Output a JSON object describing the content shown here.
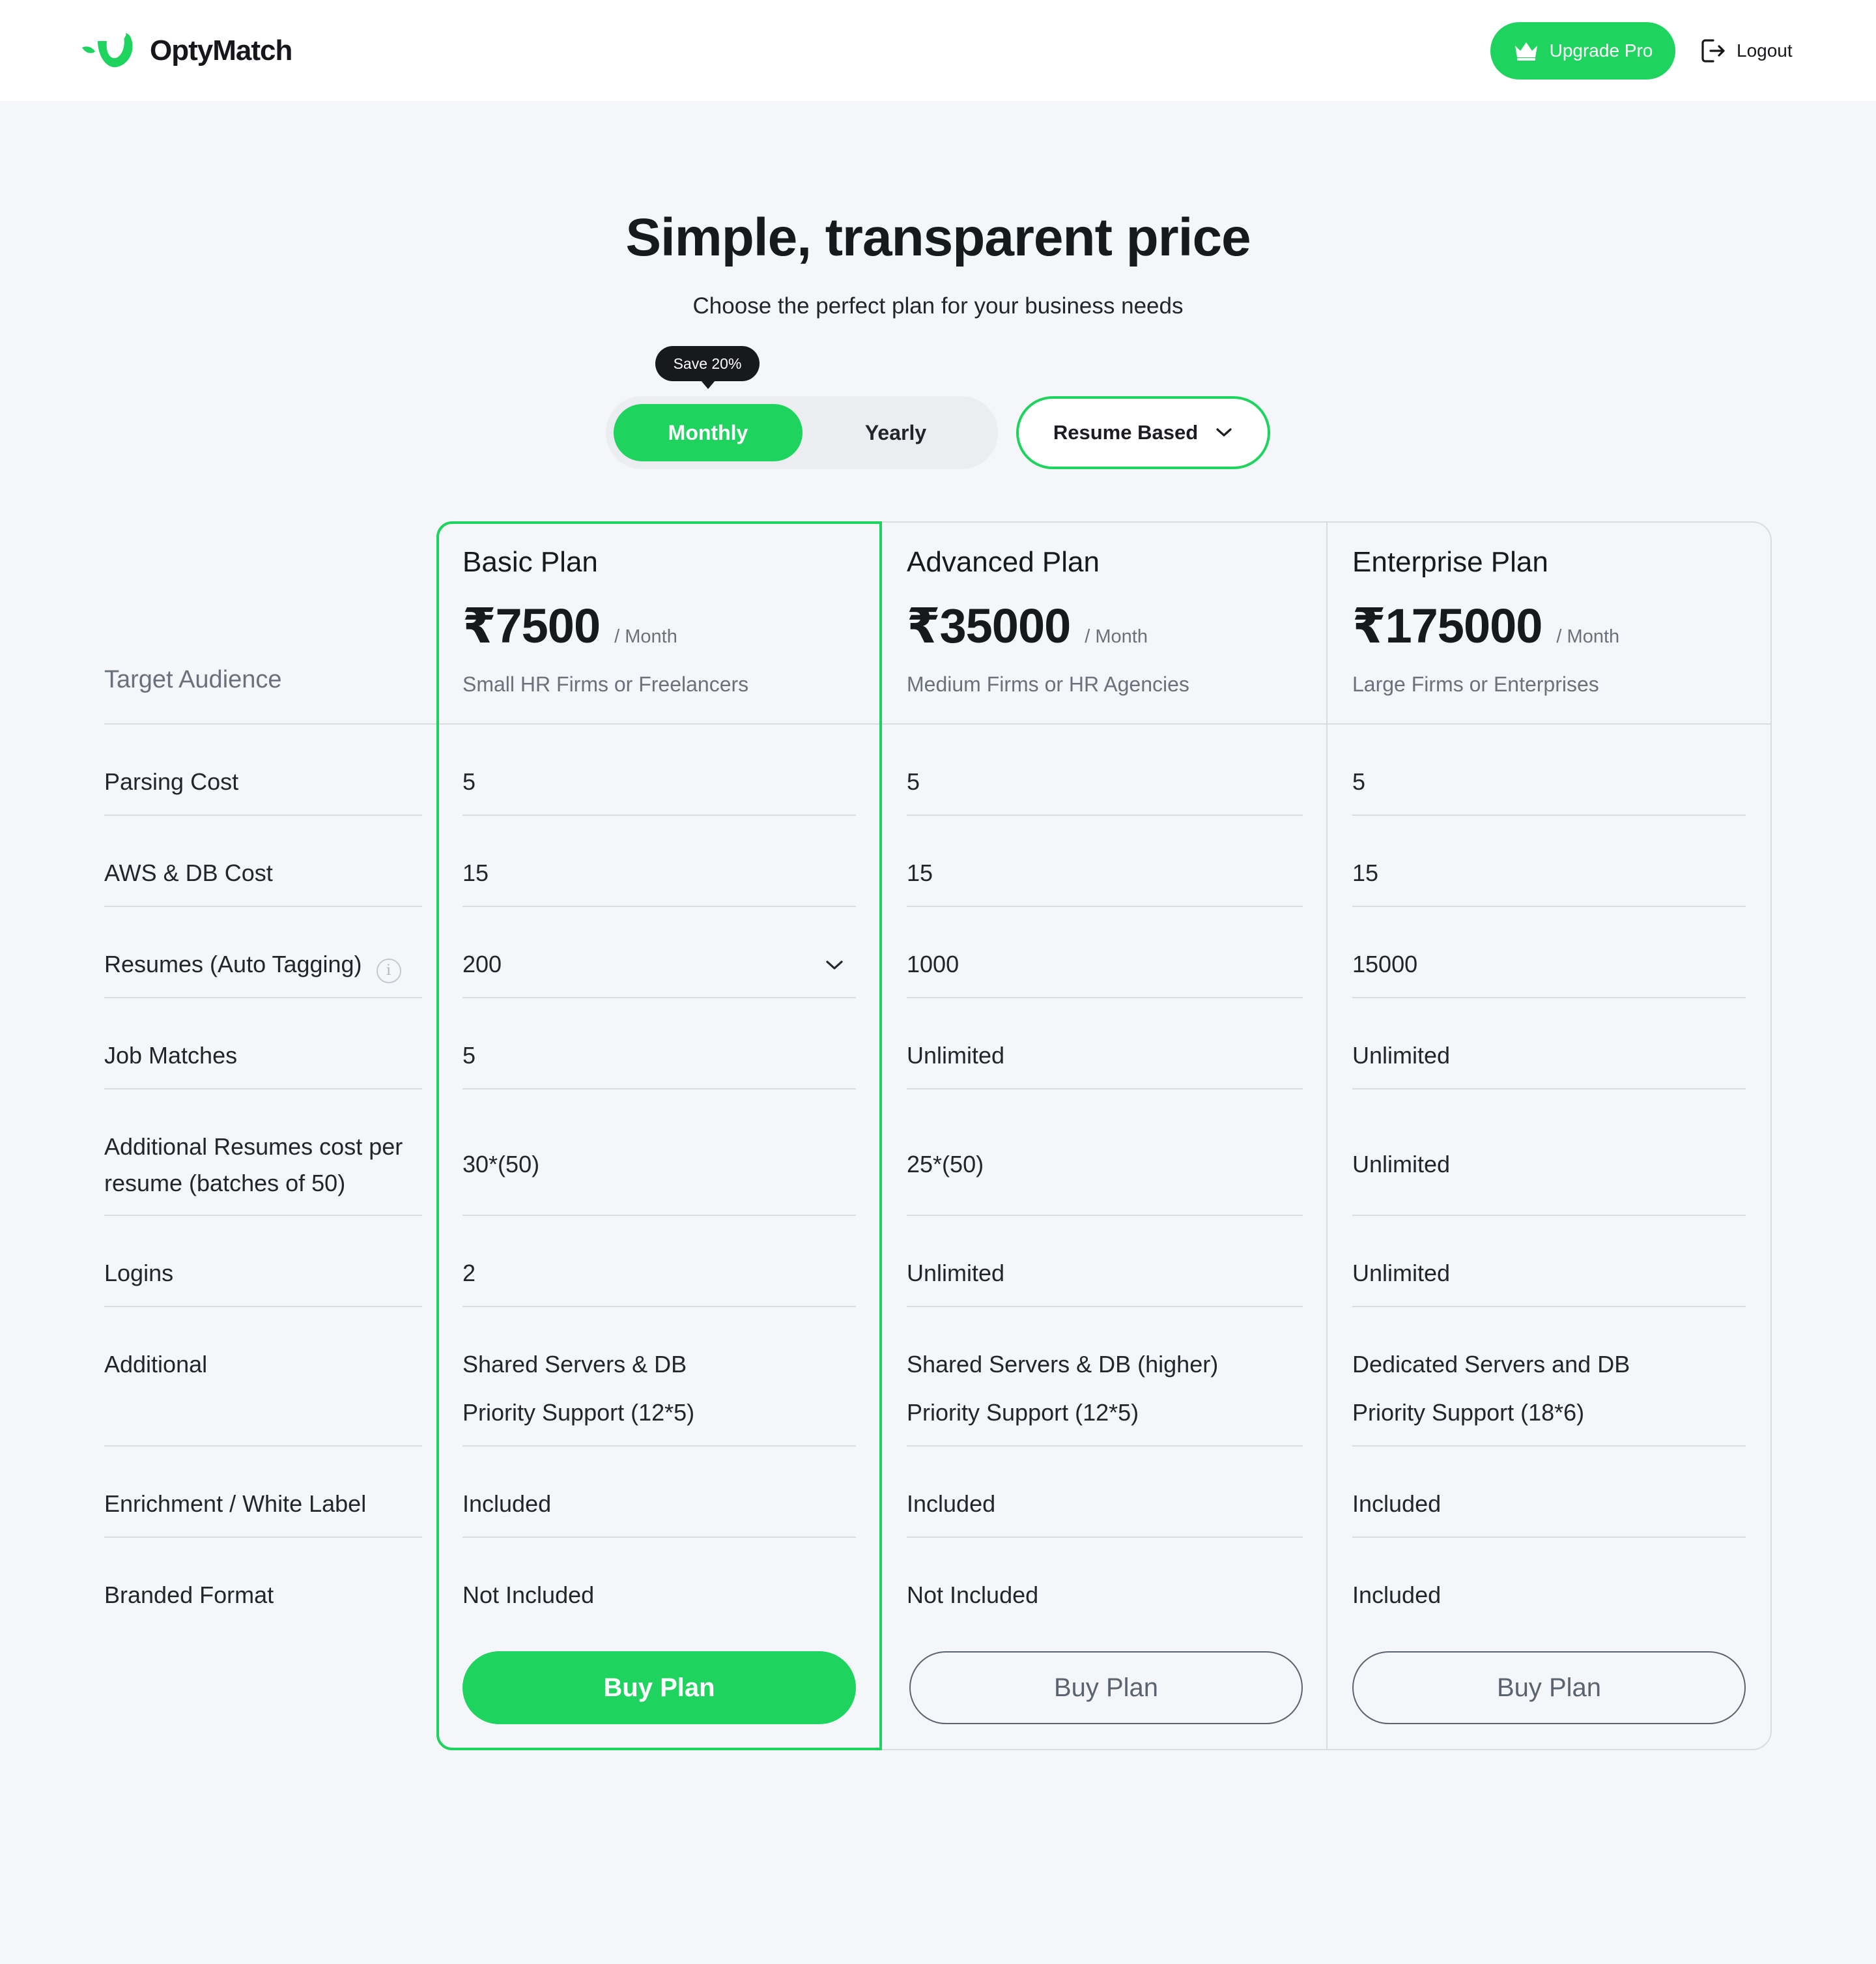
{
  "header": {
    "brand": "OptyMatch",
    "upgrade_label": "Upgrade Pro",
    "logout_label": "Logout"
  },
  "hero": {
    "title": "Simple, transparent price",
    "subtitle": "Choose the perfect plan for your business needs",
    "save_badge": "Save 20%",
    "billing_options": [
      "Monthly",
      "Yearly"
    ],
    "billing_selected": "Monthly",
    "plan_type": "Resume Based"
  },
  "colors": {
    "accent": "#1fd35f",
    "text": "#17191d",
    "muted": "#6b717c",
    "border": "#d9dce1"
  },
  "table": {
    "target_label": "Target Audience",
    "rows": [
      "Parsing Cost",
      "AWS & DB Cost",
      "Resumes (Auto Tagging)",
      "Job Matches",
      "Additional Resumes cost per resume (batches of 50)",
      "Logins",
      "Additional",
      "Enrichment / White Label",
      "Branded Format"
    ],
    "plans": [
      {
        "name": "Basic Plan",
        "price": "₹7500",
        "period": "/ Month",
        "audience": "Small HR Firms or Freelancers",
        "parsing": "5",
        "aws": "15",
        "resumes": "200",
        "job_matches": "5",
        "additional_cost": "30*(50)",
        "logins": "2",
        "additional_1": "Shared Servers & DB",
        "additional_2": "Priority Support (12*5)",
        "enrichment": "Included",
        "branded": "Not Included",
        "button": "Buy Plan"
      },
      {
        "name": "Advanced Plan",
        "price": "₹35000",
        "period": "/ Month",
        "audience": "Medium Firms or HR Agencies",
        "parsing": "5",
        "aws": "15",
        "resumes": "1000",
        "job_matches": "Unlimited",
        "additional_cost": "25*(50)",
        "logins": "Unlimited",
        "additional_1": "Shared Servers & DB (higher)",
        "additional_2": "Priority Support (12*5)",
        "enrichment": "Included",
        "branded": "Not Included",
        "button": "Buy Plan"
      },
      {
        "name": "Enterprise Plan",
        "price": "₹175000",
        "period": "/ Month",
        "audience": "Large Firms or Enterprises",
        "parsing": "5",
        "aws": "15",
        "resumes": "15000",
        "job_matches": "Unlimited",
        "additional_cost": "Unlimited",
        "logins": "Unlimited",
        "additional_1": "Dedicated Servers and DB",
        "additional_2": "Priority Support (18*6)",
        "enrichment": "Included",
        "branded": "Included",
        "button": "Buy Plan"
      }
    ]
  }
}
